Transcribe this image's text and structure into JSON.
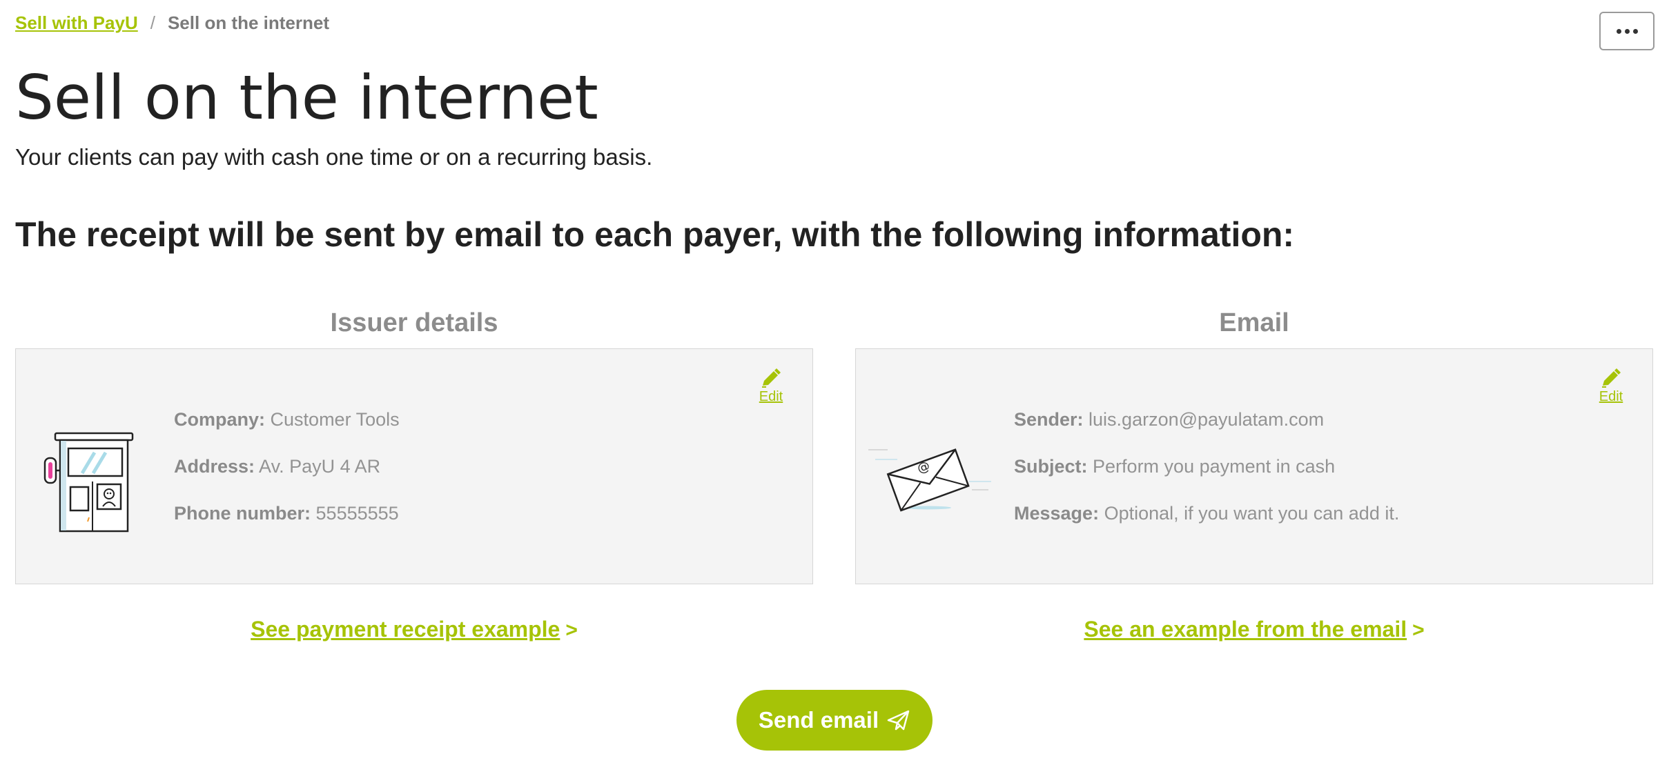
{
  "breadcrumb": {
    "parent": "Sell with PayU",
    "separator": "/",
    "current": "Sell on the internet"
  },
  "header": {
    "title": "Sell on the internet",
    "subtitle": "Your clients can pay with cash one time or on a recurring basis."
  },
  "section": {
    "heading": "The receipt will be sent by email to each payer, with the following information:"
  },
  "issuer": {
    "title": "Issuer details",
    "edit_label": "Edit",
    "fields": [
      {
        "label": "Company:",
        "value": "Customer Tools"
      },
      {
        "label": "Address:",
        "value": "Av. PayU 4 AR"
      },
      {
        "label": "Phone number:",
        "value": "55555555"
      }
    ],
    "example_link": "See payment receipt example",
    "example_chevron": ">"
  },
  "email": {
    "title": "Email",
    "edit_label": "Edit",
    "fields": [
      {
        "label": "Sender:",
        "value": "luis.garzon@payulatam.com"
      },
      {
        "label": "Subject:",
        "value": "Perform you payment in cash"
      },
      {
        "label": "Message:",
        "value": "Optional, if you want you can add it."
      }
    ],
    "example_link": "See an example from the email",
    "example_chevron": ">"
  },
  "actions": {
    "send_label": "Send email"
  },
  "colors": {
    "accent": "#a6c307",
    "card_background": "#f4f4f4",
    "muted_text": "#8c8c8c"
  },
  "icons": {
    "more": "more-horizontal-icon",
    "edit": "pencil-icon",
    "issuer_illustration": "kiosk-illustration",
    "email_illustration": "envelope-illustration",
    "send": "paper-plane-icon"
  }
}
